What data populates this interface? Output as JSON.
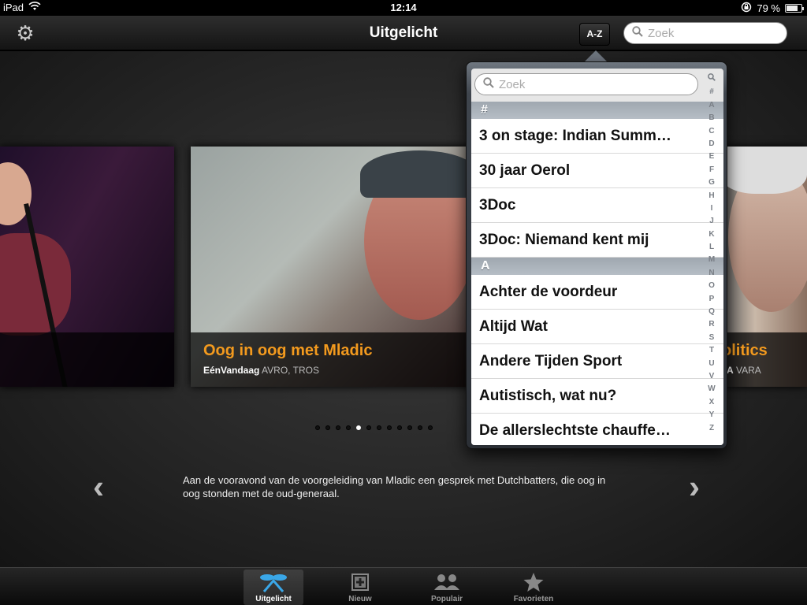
{
  "status_bar": {
    "device": "iPad",
    "time": "12:14",
    "battery_percent": "79 %",
    "battery_level": 0.79
  },
  "nav": {
    "title": "Uitgelicht",
    "az_button": "A-Z",
    "search_placeholder": "Zoek"
  },
  "carousel": {
    "center": {
      "title": "Oog in oog met Mladic",
      "program": "EénVandaag",
      "broadcasters": "AVRO, TROS"
    },
    "right": {
      "title": "olitics",
      "program": "A",
      "broadcasters": "VARA"
    },
    "dot_count": 12,
    "active_dot": 4
  },
  "description": "Aan de vooravond van de voorgeleiding van Mladic een gesprek met Dutchbatters, die oog in oog stonden met de oud-generaal.",
  "popover": {
    "search_placeholder": "Zoek",
    "sections": [
      {
        "header": "#",
        "items": [
          "3 on stage: Indian Summ…",
          "30 jaar Oerol",
          "3Doc",
          "3Doc: Niemand kent mij"
        ]
      },
      {
        "header": "A",
        "items": [
          "Achter de voordeur",
          "Altijd Wat",
          "Andere Tijden Sport",
          "Autistisch, wat nu?",
          "De allerslechtste chauffe…"
        ]
      }
    ],
    "index": [
      "Q",
      "#",
      "A",
      "B",
      "C",
      "D",
      "E",
      "F",
      "G",
      "H",
      "I",
      "J",
      "K",
      "L",
      "M",
      "N",
      "O",
      "P",
      "Q",
      "R",
      "S",
      "T",
      "U",
      "V",
      "W",
      "X",
      "Y",
      "Z"
    ]
  },
  "tabs": [
    {
      "label": "Uitgelicht",
      "icon": "featured-icon",
      "active": true
    },
    {
      "label": "Nieuw",
      "icon": "plus-square-icon",
      "active": false
    },
    {
      "label": "Populair",
      "icon": "people-icon",
      "active": false
    },
    {
      "label": "Favorieten",
      "icon": "star-icon",
      "active": false
    }
  ]
}
